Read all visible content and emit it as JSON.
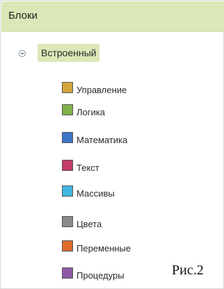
{
  "panel": {
    "title": "Блоки"
  },
  "tree": {
    "root_label": "Встроенный",
    "items": [
      {
        "label": "Управление",
        "color": "#d4a73a"
      },
      {
        "label": "Логика",
        "color": "#7fb24a"
      },
      {
        "label": "Математика",
        "color": "#3d74c6"
      },
      {
        "label": "Текст",
        "color": "#c23b6a"
      },
      {
        "label": "Массивы",
        "color": "#3fb6df"
      },
      {
        "label": "Цвета",
        "color": "#8a8a8a"
      },
      {
        "label": "Переменные",
        "color": "#e06a2c"
      },
      {
        "label": "Процедуры",
        "color": "#8e5ba6"
      }
    ]
  },
  "figure_label": "Рис.2"
}
